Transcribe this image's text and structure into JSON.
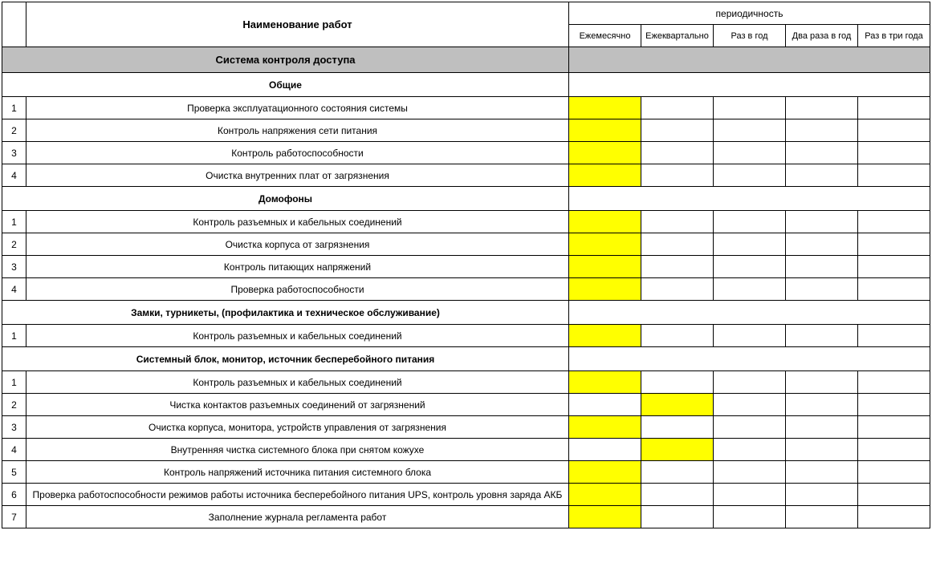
{
  "headers": {
    "name": "Наименование работ",
    "periodicity": "периодичность",
    "freq_cols": [
      "Ежемесячно",
      "Ежеквартально",
      "Раз в год",
      "Два раза в год",
      "Раз в три года"
    ]
  },
  "section_title": "Система контроля доступа",
  "groups": [
    {
      "title": "Общие",
      "rows": [
        {
          "num": "1",
          "name": "Проверка эксплуатационного состояния системы",
          "marks": [
            true,
            false,
            false,
            false,
            false
          ]
        },
        {
          "num": "2",
          "name": "Контроль напряжения сети питания",
          "marks": [
            true,
            false,
            false,
            false,
            false
          ]
        },
        {
          "num": "3",
          "name": "Контроль работоспособности",
          "marks": [
            true,
            false,
            false,
            false,
            false
          ]
        },
        {
          "num": "4",
          "name": "Очистка  внутренних плат от загрязнения",
          "marks": [
            true,
            false,
            false,
            false,
            false
          ]
        }
      ]
    },
    {
      "title": "Домофоны",
      "rows": [
        {
          "num": "1",
          "name": "Контроль разъемных и кабельных соединений",
          "marks": [
            true,
            false,
            false,
            false,
            false
          ]
        },
        {
          "num": "2",
          "name": "Очистка корпуса от загрязнения",
          "marks": [
            true,
            false,
            false,
            false,
            false
          ]
        },
        {
          "num": "3",
          "name": "Контроль питающих напряжений",
          "marks": [
            true,
            false,
            false,
            false,
            false
          ]
        },
        {
          "num": "4",
          "name": "Проверка работоспособности",
          "marks": [
            true,
            false,
            false,
            false,
            false
          ]
        }
      ]
    },
    {
      "title": "Замки, турникеты,  (профилактика и техническое обслуживание)",
      "rows": [
        {
          "num": "1",
          "name": "Контроль разъемных и кабельных соединений",
          "marks": [
            true,
            false,
            false,
            false,
            false
          ]
        }
      ]
    },
    {
      "title": "Системный  блок, монитор, источник бесперебойного питания",
      "rows": [
        {
          "num": "1",
          "name": "Контроль разъемных и кабельных соединений",
          "marks": [
            true,
            false,
            false,
            false,
            false
          ]
        },
        {
          "num": "2",
          "name": "Чистка контактов разъемных соединений от загрязнений",
          "marks": [
            false,
            true,
            false,
            false,
            false
          ]
        },
        {
          "num": "3",
          "name": "Очистка корпуса, монитора, устройств управления от загрязнения",
          "marks": [
            true,
            false,
            false,
            false,
            false
          ]
        },
        {
          "num": "4",
          "name": "Внутренняя чистка системного блока при снятом кожухе",
          "marks": [
            false,
            true,
            false,
            false,
            false
          ]
        },
        {
          "num": "5",
          "name": "Контроль напряжений источника питания системного блока",
          "marks": [
            true,
            false,
            false,
            false,
            false
          ]
        },
        {
          "num": "6",
          "name": "Проверка работоспособности режимов работы источника бесперебойного питания UPS, контроль уровня заряда АКБ",
          "marks": [
            true,
            false,
            false,
            false,
            false
          ]
        },
        {
          "num": "7",
          "name": "Заполнение журнала регламента работ",
          "marks": [
            true,
            false,
            false,
            false,
            false
          ]
        }
      ]
    }
  ]
}
